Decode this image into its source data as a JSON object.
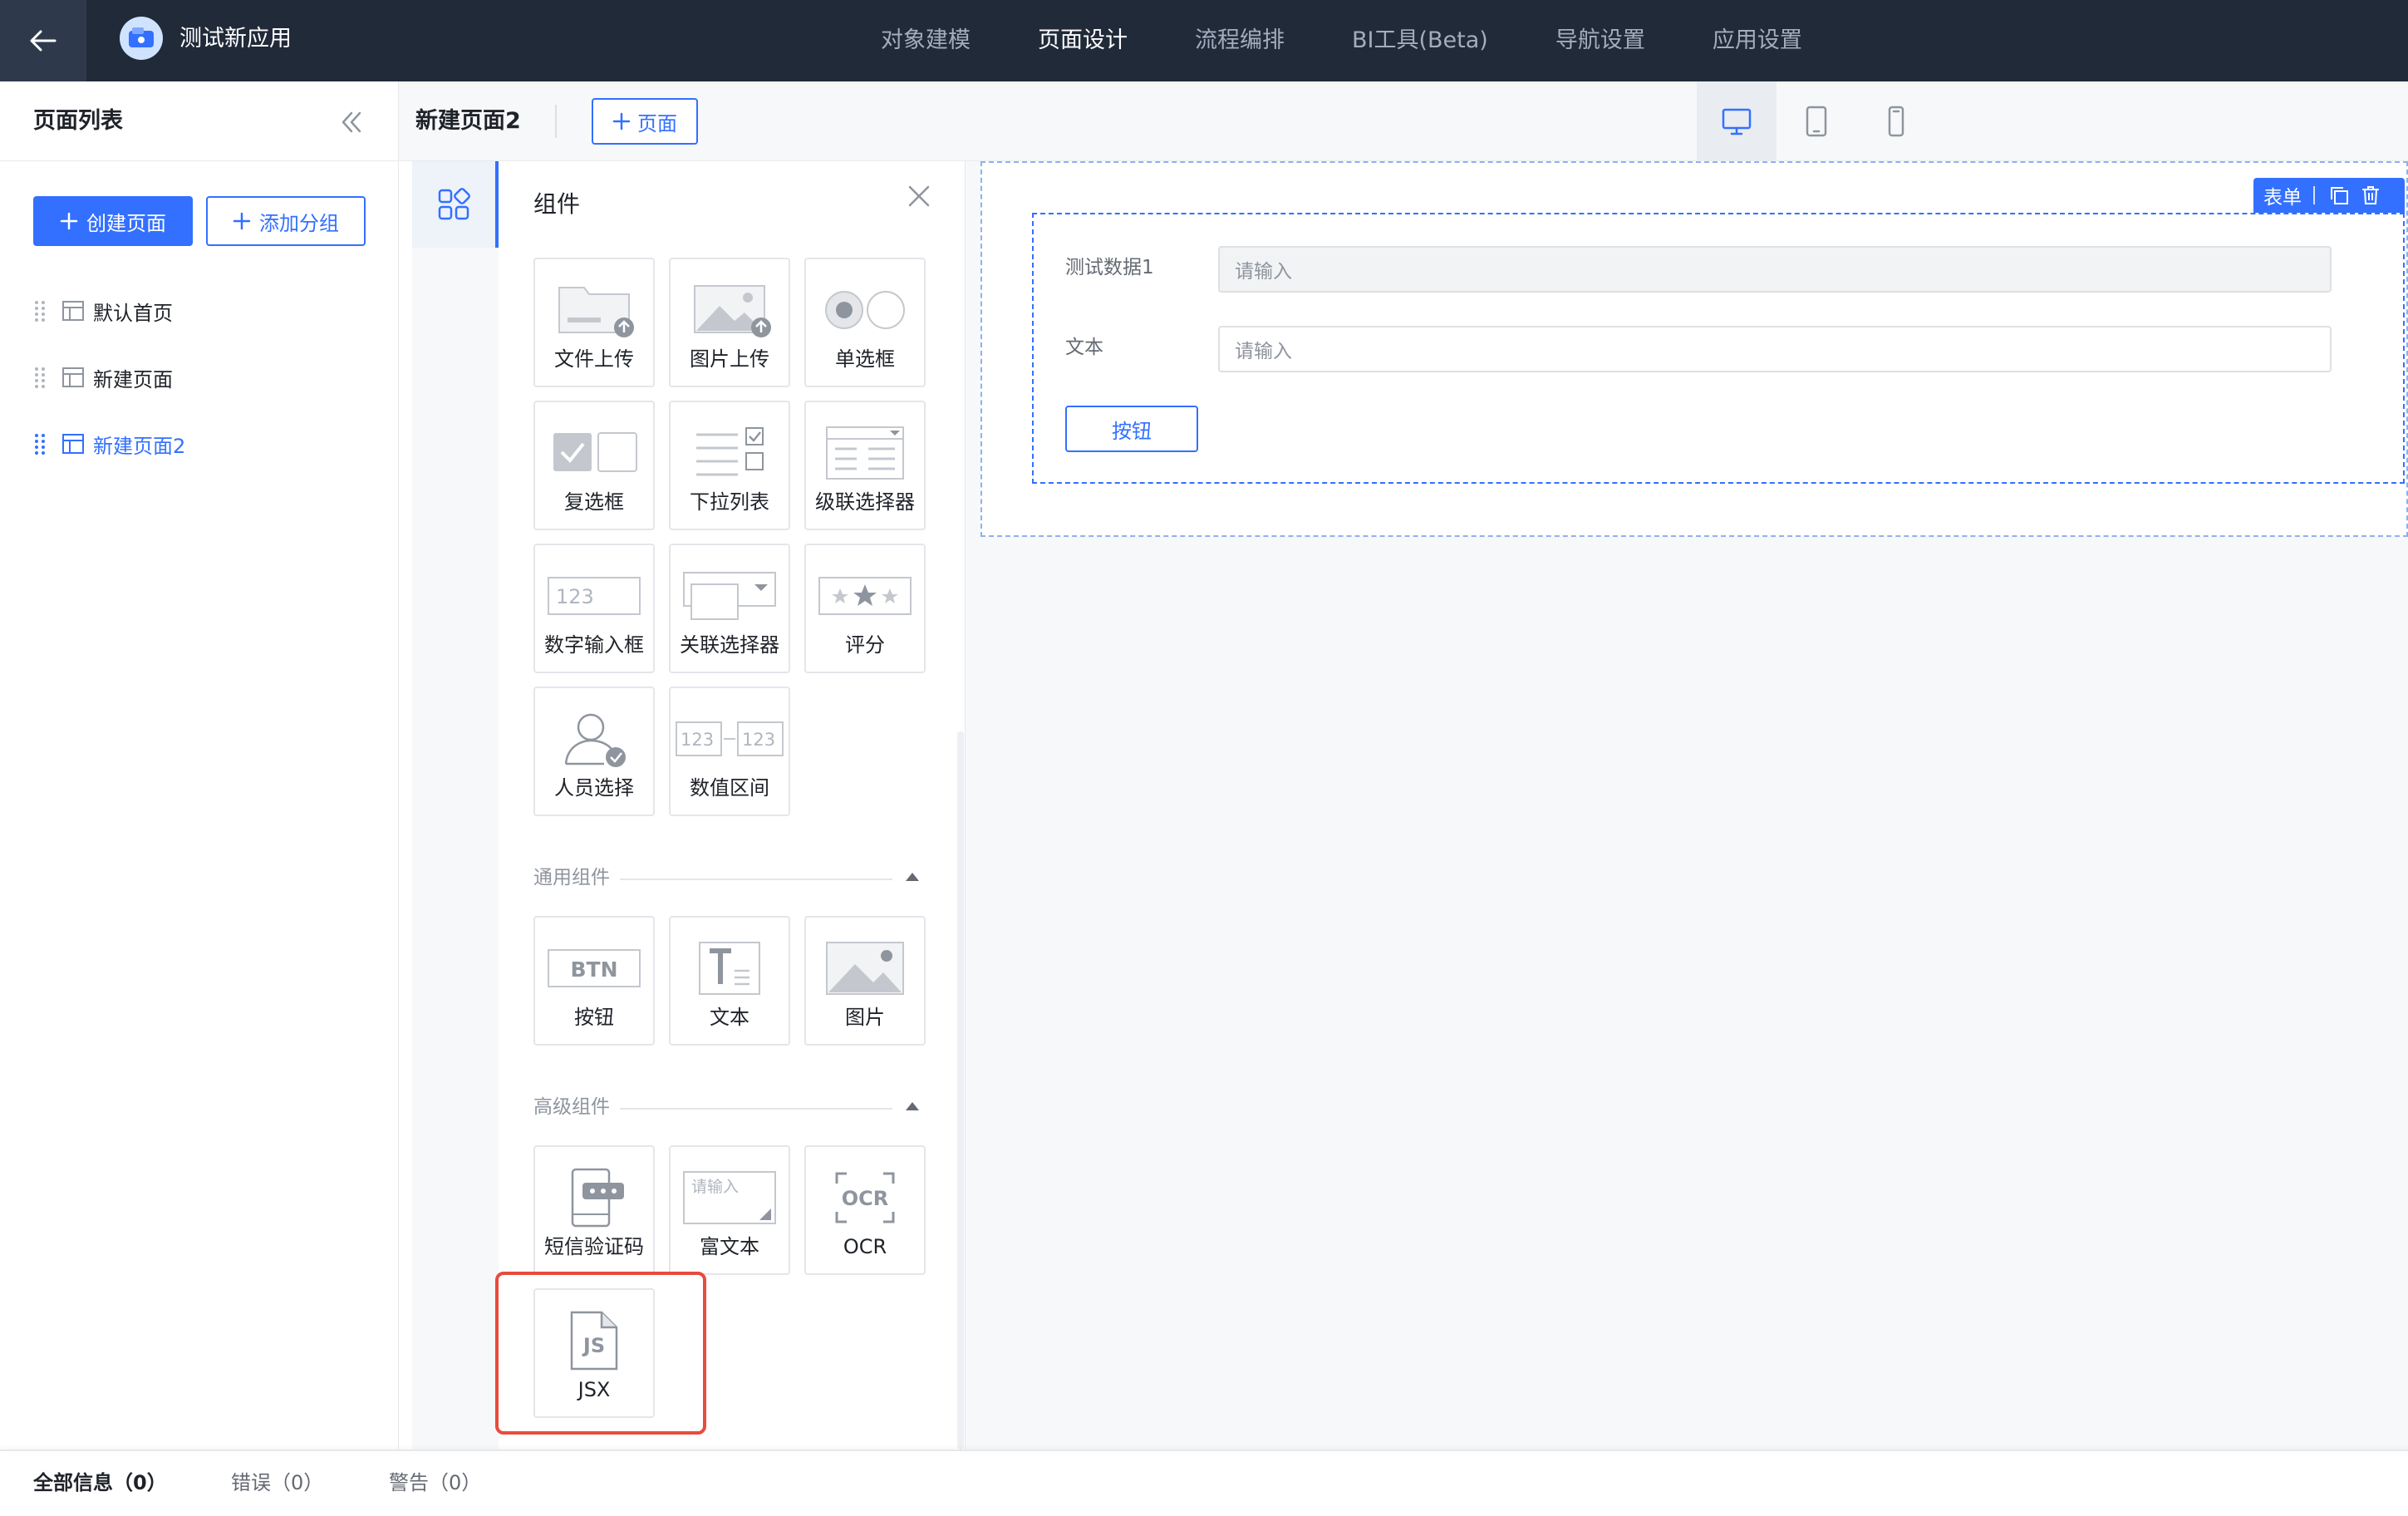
{
  "app": {
    "title": "测试新应用"
  },
  "nav": {
    "items": [
      {
        "label": "对象建模",
        "active": false
      },
      {
        "label": "页面设计",
        "active": true
      },
      {
        "label": "流程编排",
        "active": false
      },
      {
        "label": "BI工具(Beta)",
        "active": false
      },
      {
        "label": "导航设置",
        "active": false
      },
      {
        "label": "应用设置",
        "active": false
      }
    ]
  },
  "sidebar": {
    "title": "页面列表",
    "create_page_label": "创建页面",
    "add_group_label": "添加分组",
    "pages": [
      {
        "label": "默认首页",
        "active": false
      },
      {
        "label": "新建页面",
        "active": false
      },
      {
        "label": "新建页面2",
        "active": true
      }
    ]
  },
  "header": {
    "page_name": "新建页面2",
    "add_page_label": "页面",
    "devices": [
      "desktop-icon",
      "tablet-icon",
      "mobile-icon"
    ],
    "active_device": "desktop-icon"
  },
  "panel": {
    "title": "组件",
    "form_components": [
      {
        "label": "文件上传",
        "icon": "file-upload-icon"
      },
      {
        "label": "图片上传",
        "icon": "image-upload-icon"
      },
      {
        "label": "单选框",
        "icon": "radio-icon"
      },
      {
        "label": "复选框",
        "icon": "checkbox-icon"
      },
      {
        "label": "下拉列表",
        "icon": "dropdown-list-icon"
      },
      {
        "label": "级联选择器",
        "icon": "cascader-icon"
      },
      {
        "label": "数字输入框",
        "icon": "number-input-icon"
      },
      {
        "label": "关联选择器",
        "icon": "relation-select-icon"
      },
      {
        "label": "评分",
        "icon": "rating-icon"
      },
      {
        "label": "人员选择",
        "icon": "user-select-icon"
      },
      {
        "label": "数值区间",
        "icon": "number-range-icon"
      }
    ],
    "general_section": "通用组件",
    "general_components": [
      {
        "label": "按钮",
        "icon": "button-icon"
      },
      {
        "label": "文本",
        "icon": "text-icon"
      },
      {
        "label": "图片",
        "icon": "image-icon"
      }
    ],
    "advanced_section": "高级组件",
    "advanced_components": [
      {
        "label": "短信验证码",
        "icon": "sms-code-icon"
      },
      {
        "label": "富文本",
        "icon": "rich-text-icon"
      },
      {
        "label": "OCR",
        "icon": "ocr-icon"
      },
      {
        "label": "JSX",
        "icon": "jsx-file-icon"
      }
    ],
    "icon_texts": {
      "number": "123",
      "range_a": "123",
      "range_b": "123",
      "btn": "BTN",
      "rich_placeholder": "请输入",
      "ocr": "OCR",
      "js": "JS"
    }
  },
  "canvas": {
    "form_toolbar_label": "表单",
    "fields": [
      {
        "label": "测试数据1",
        "placeholder": "请输入",
        "disabled": true
      },
      {
        "label": "文本",
        "placeholder": "请输入",
        "disabled": false
      }
    ],
    "button_label": "按钮"
  },
  "bottom": {
    "tabs": [
      {
        "label": "全部信息（0）",
        "active": true
      },
      {
        "label": "错误（0）",
        "active": false
      },
      {
        "label": "警告（0）",
        "active": false
      }
    ]
  },
  "colors": {
    "topbar": "#202a39",
    "primary": "#3370ff",
    "highlight": "#e74c3c"
  }
}
